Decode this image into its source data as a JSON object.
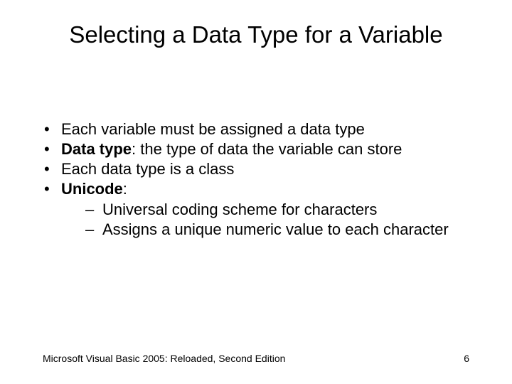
{
  "title": "Selecting a Data Type for a Variable",
  "bullets": {
    "b1": "Each variable must be assigned a data type",
    "b2_bold": "Data type",
    "b2_rest": ": the type of data the variable can store",
    "b3": "Each data type is a class",
    "b4_bold": "Unicode",
    "b4_rest": ":",
    "sub1": "Universal coding scheme for characters",
    "sub2": "Assigns a unique numeric value to each character"
  },
  "footer": {
    "left": "Microsoft Visual Basic 2005: Reloaded, Second Edition",
    "page": "6"
  }
}
